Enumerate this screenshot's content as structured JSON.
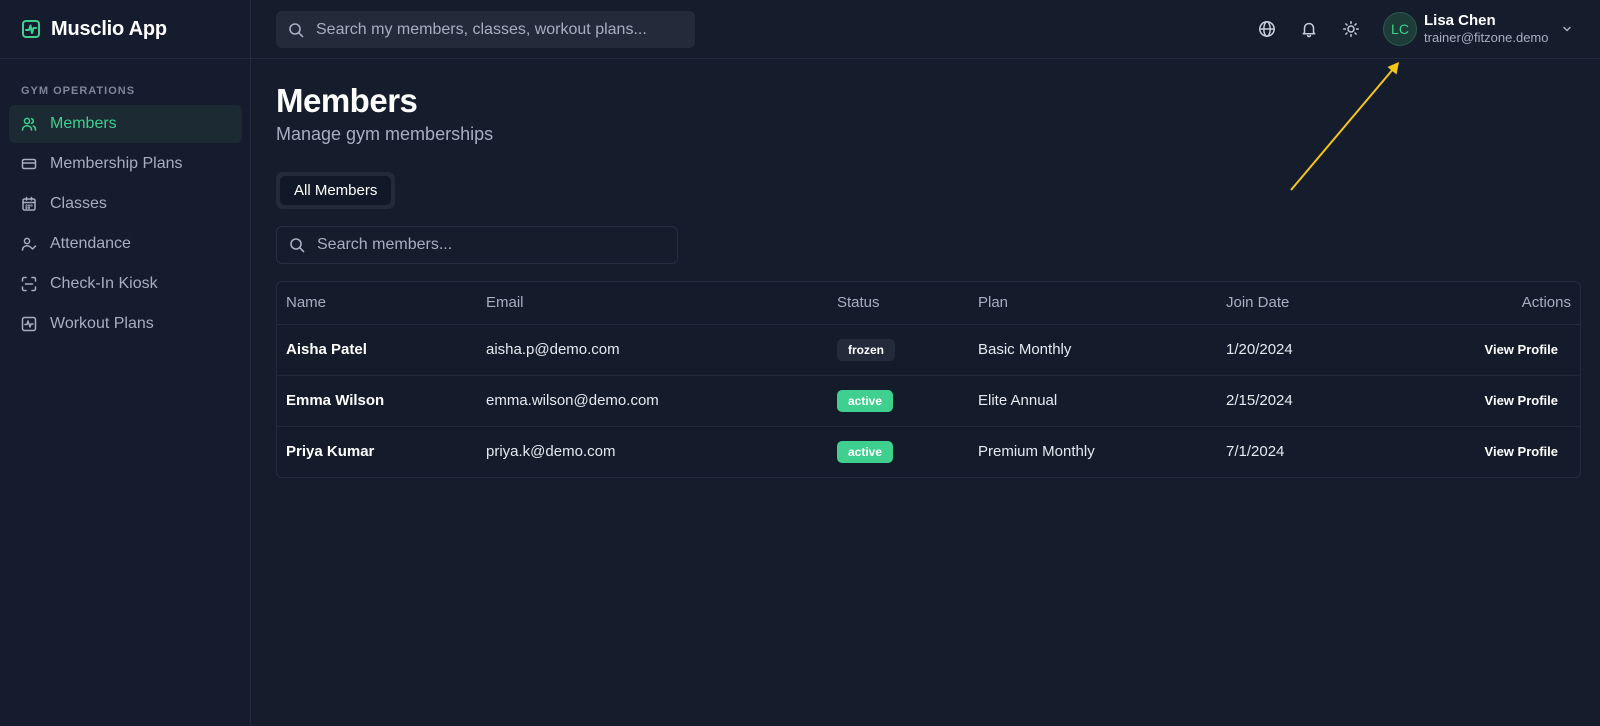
{
  "app": {
    "name": "Musclio App"
  },
  "sidebar": {
    "section_label": "GYM OPERATIONS",
    "items": [
      {
        "label": "Members",
        "icon": "users-icon",
        "active": true
      },
      {
        "label": "Membership Plans",
        "icon": "credit-card-icon"
      },
      {
        "label": "Classes",
        "icon": "calendar-icon"
      },
      {
        "label": "Attendance",
        "icon": "user-check-icon"
      },
      {
        "label": "Check-In Kiosk",
        "icon": "scan-icon"
      },
      {
        "label": "Workout Plans",
        "icon": "activity-square-icon"
      }
    ]
  },
  "topbar": {
    "search_placeholder": "Search my members, classes, workout plans...",
    "icons": [
      "globe-icon",
      "bell-icon",
      "sun-icon"
    ],
    "user": {
      "initials": "LC",
      "name": "Lisa Chen",
      "email": "trainer@fitzone.demo"
    }
  },
  "page": {
    "title": "Members",
    "subtitle": "Manage gym memberships",
    "tabs": [
      {
        "label": "All Members",
        "active": true
      }
    ],
    "search_placeholder": "Search members..."
  },
  "table": {
    "headers": {
      "name": "Name",
      "email": "Email",
      "status": "Status",
      "plan": "Plan",
      "join_date": "Join Date",
      "actions": "Actions"
    },
    "rows": [
      {
        "name": "Aisha Patel",
        "email": "aisha.p@demo.com",
        "status": "frozen",
        "plan": "Basic Monthly",
        "join_date": "1/20/2024",
        "action": "View Profile"
      },
      {
        "name": "Emma Wilson",
        "email": "emma.wilson@demo.com",
        "status": "active",
        "plan": "Elite Annual",
        "join_date": "2/15/2024",
        "action": "View Profile"
      },
      {
        "name": "Priya Kumar",
        "email": "priya.k@demo.com",
        "status": "active",
        "plan": "Premium Monthly",
        "join_date": "7/1/2024",
        "action": "View Profile"
      }
    ]
  },
  "colors": {
    "accent": "#3fcf8e",
    "background": "#151c2c",
    "sidebar": "#141c2d",
    "annotation_arrow": "#f5c518"
  }
}
